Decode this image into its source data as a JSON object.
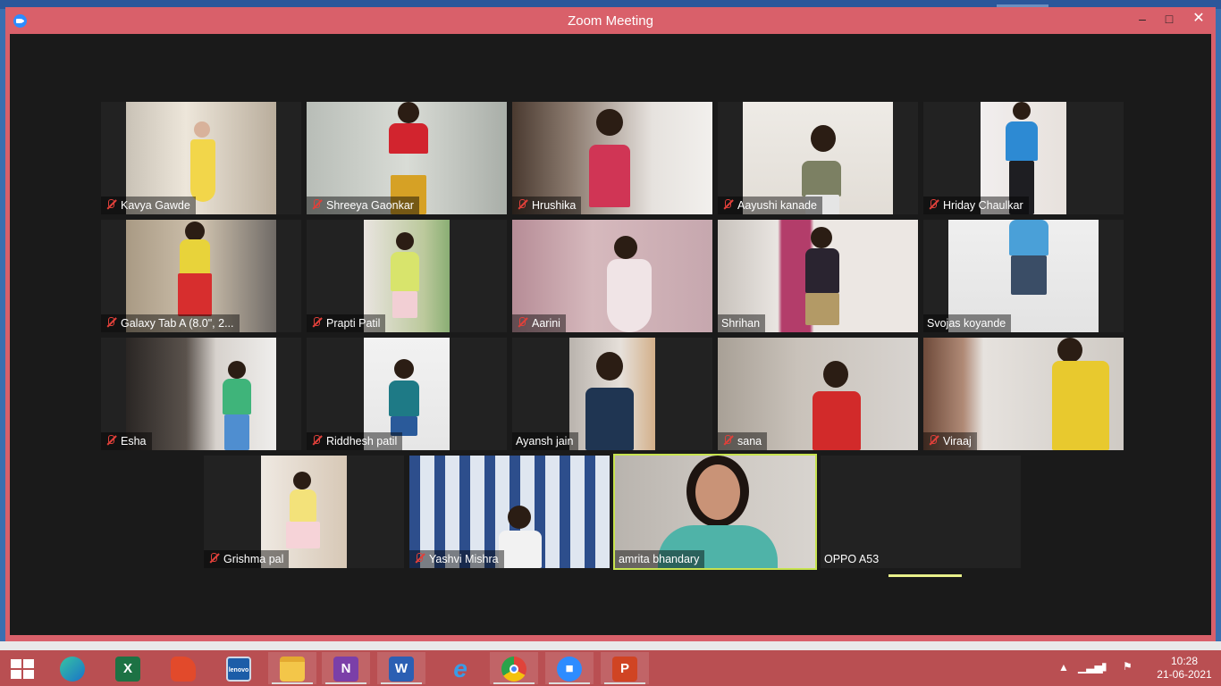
{
  "window": {
    "title": "Zoom Meeting",
    "controls": {
      "minimize": "–",
      "maximize": "□",
      "close": "✕"
    }
  },
  "participants": [
    {
      "name": "Kavya Gawde",
      "muted": true
    },
    {
      "name": "Shreeya Gaonkar",
      "muted": true
    },
    {
      "name": "Hrushika",
      "muted": true
    },
    {
      "name": "Aayushi kanade",
      "muted": true
    },
    {
      "name": "Hriday Chaulkar",
      "muted": true
    },
    {
      "name": "Galaxy Tab A (8.0\", 2...",
      "muted": true
    },
    {
      "name": "Prapti Patil",
      "muted": true
    },
    {
      "name": "Aarini",
      "muted": true
    },
    {
      "name": "Shrihan",
      "muted": false
    },
    {
      "name": "Svojas koyande",
      "muted": false
    },
    {
      "name": "Esha",
      "muted": true
    },
    {
      "name": "Riddhesh patil",
      "muted": true
    },
    {
      "name": "Ayansh jain",
      "muted": false
    },
    {
      "name": "sana",
      "muted": true
    },
    {
      "name": "Viraaj",
      "muted": true
    },
    {
      "name": "Grishma pal",
      "muted": true
    },
    {
      "name": "Yashvi Mishra",
      "muted": true
    },
    {
      "name": "amrita bhandary",
      "muted": false,
      "active_speaker": true
    },
    {
      "name": "OPPO A53",
      "muted": false,
      "video_off": true
    }
  ],
  "taskbar": {
    "apps": [
      "edge-icon",
      "excel-icon",
      "presenter-icon",
      "lenovo-icon",
      "file-explorer-icon",
      "onenote-icon",
      "word-icon",
      "internet-explorer-icon",
      "chrome-icon",
      "zoom-icon",
      "powerpoint-icon"
    ],
    "clock": {
      "time": "10:28",
      "date": "21-06-2021"
    }
  },
  "colors": {
    "window_frame": "#d9606a",
    "taskbar": "#b94f52",
    "active_speaker": "#c7e34f",
    "mute_icon": "#e0403a"
  }
}
